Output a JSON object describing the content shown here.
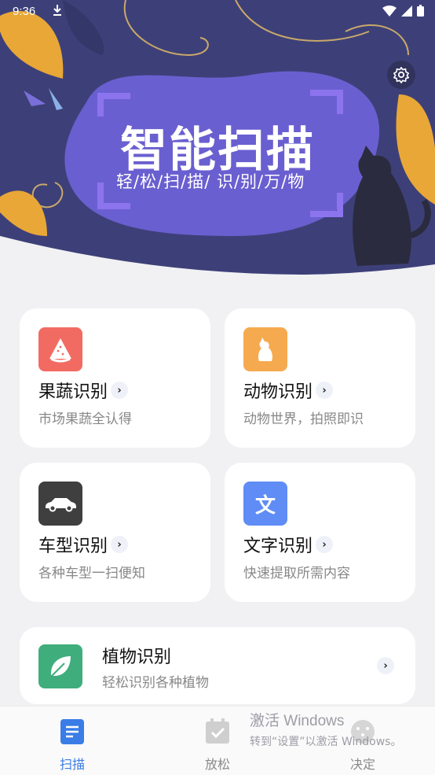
{
  "status_bar": {
    "time": "9:36"
  },
  "hero": {
    "title": "智能扫描",
    "subtitle": "轻/松/扫/描/ 识/别/万/物"
  },
  "cards": [
    {
      "title": "果蔬识别",
      "subtitle": "市场果蔬全认得",
      "icon": "watermelon-icon",
      "color": "#f26b62"
    },
    {
      "title": "动物识别",
      "subtitle": "动物世界，拍照即识",
      "icon": "cat-icon",
      "color": "#f6aa4f"
    },
    {
      "title": "车型识别",
      "subtitle": "各种车型一扫便知",
      "icon": "car-icon",
      "color": "#3f3f3f"
    },
    {
      "title": "文字识别",
      "subtitle": "快速提取所需内容",
      "icon": "text-icon",
      "color": "#5f8df5",
      "icon_glyph": "文"
    }
  ],
  "plant_card": {
    "title": "植物识别",
    "subtitle": "轻松识别各种植物",
    "icon": "leaf-icon",
    "color": "#3fae7c"
  },
  "bottom_nav": [
    {
      "label": "扫描",
      "active": true,
      "icon": "scan-doc-icon"
    },
    {
      "label": "放松",
      "active": false,
      "icon": "calendar-check-icon"
    },
    {
      "label": "决定",
      "active": false,
      "icon": "dice-icon"
    }
  ],
  "watermark": {
    "line1": "激活 Windows",
    "line2": "转到“设置”以激活 Windows。"
  },
  "colors": {
    "hero_bg": "#3d4078",
    "blob": "#6a5fd0",
    "accent": "#3b7de6",
    "nav_inactive": "#8a8a8a"
  }
}
